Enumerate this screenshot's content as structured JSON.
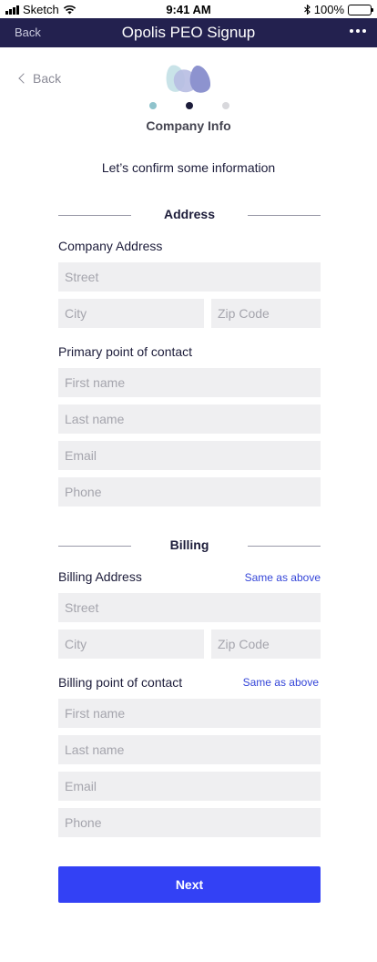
{
  "status_bar": {
    "carrier": "Sketch",
    "time": "9:41 AM",
    "battery": "100%",
    "battery_level": 1.0
  },
  "nav_bar": {
    "back_label": "Back",
    "title": "Opolis PEO Signup"
  },
  "header": {
    "back_label": "Back",
    "steps": [
      {
        "state": "done",
        "color": "#8fc3cc"
      },
      {
        "state": "current",
        "color": "#1c1c3a"
      },
      {
        "state": "pending",
        "color": "#d8d8dc"
      }
    ],
    "step_title": "Company Info",
    "intro": "Let’s confirm some information"
  },
  "address": {
    "heading": "Address",
    "company_address_label": "Company Address",
    "street_placeholder": "Street",
    "city_placeholder": "City",
    "zip_placeholder": "Zip Code",
    "contact_label": "Primary point of contact",
    "first_name_placeholder": "First name",
    "last_name_placeholder": "Last name",
    "email_placeholder": "Email",
    "phone_placeholder": "Phone"
  },
  "billing": {
    "heading": "Billing",
    "address_label": "Billing Address",
    "address_same_link": "Same as above",
    "street_placeholder": "Street",
    "city_placeholder": "City",
    "zip_placeholder": "Zip Code",
    "contact_label": "Billing point of contact",
    "contact_same_link": "Same as above",
    "first_name_placeholder": "First name",
    "last_name_placeholder": "Last name",
    "email_placeholder": "Email",
    "phone_placeholder": "Phone"
  },
  "footer": {
    "next_label": "Next"
  },
  "colors": {
    "nav": "#23214f",
    "accent": "#3341f5",
    "link": "#3546d8",
    "field_bg": "#efeff1"
  }
}
